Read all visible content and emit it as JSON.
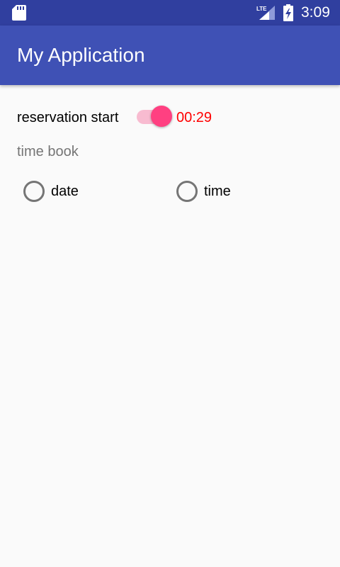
{
  "status_bar": {
    "time": "3:09",
    "network_label": "LTE",
    "icons": [
      "sd-card-icon",
      "lte-signal-icon",
      "battery-charging-icon"
    ]
  },
  "app_bar": {
    "title": "My Application"
  },
  "reservation": {
    "label": "reservation start",
    "switch_on": true,
    "timer": "00:29"
  },
  "time_book": {
    "label": "time book",
    "options": [
      {
        "label": "date",
        "checked": false
      },
      {
        "label": "time",
        "checked": false
      }
    ]
  },
  "colors": {
    "status_bar": "#303f9f",
    "app_bar": "#3f51b5",
    "accent": "#ff4081",
    "timer_text": "#ff0000",
    "secondary_text": "#757575"
  }
}
